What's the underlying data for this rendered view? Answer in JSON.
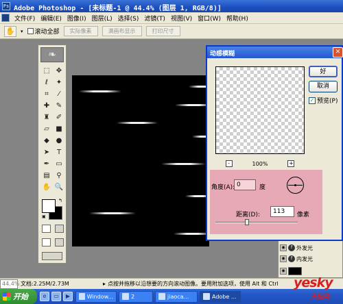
{
  "window": {
    "title": "Adobe Photoshop - [未标题-1 @ 44.4% (图层 1, RGB/8)]"
  },
  "menu": {
    "items": [
      "文件(F)",
      "编辑(E)",
      "图像(I)",
      "图层(L)",
      "选择(S)",
      "滤镜(T)",
      "视图(V)",
      "窗口(W)",
      "帮助(H)"
    ]
  },
  "options": {
    "scroll_all_label": "滚动全部",
    "actual_pixels": "实际像素",
    "fit_screen": "满画布显示",
    "print_size": "打印尺寸"
  },
  "dialog": {
    "title": "动感模糊",
    "ok": "好",
    "cancel": "取消",
    "preview_label": "预览(P)",
    "zoom": "100%",
    "zoom_minus": "-",
    "zoom_plus": "+",
    "angle_label": "角度(A):",
    "angle_value": "0",
    "angle_unit": "度",
    "distance_label": "距离(D):",
    "distance_value": "113",
    "distance_unit": "像素",
    "distance_fraction": 0.38
  },
  "layers": {
    "outer_glow": "外发光",
    "inner_glow": "内发光"
  },
  "status": {
    "zoom": "44.4%",
    "doc": "文档:2.25M/2.73M",
    "arrow": "▸",
    "hint": "点按并拖移以沿想要的方向滚动图像。要用附加选项，使用 Alt 和 Ctrl"
  },
  "taskbar": {
    "start": "开始",
    "tasks": [
      "Window...",
      "2",
      "jiaoca...",
      "Adobe ..."
    ]
  },
  "watermark": {
    "brand": "yesky",
    "sub": "天极网"
  },
  "colors": {
    "title_blue": "#1b4fc0",
    "dialog_param_bg": "#e6a9b5",
    "canvas_bg": "#000000",
    "watermark_red": "#d62020"
  }
}
